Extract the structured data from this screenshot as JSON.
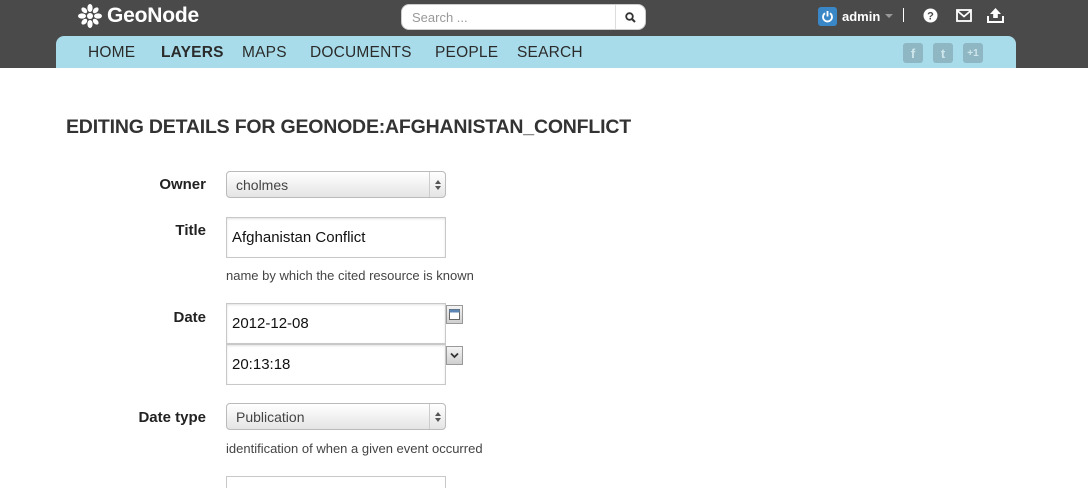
{
  "header": {
    "logo_text": "GeoNode",
    "search": {
      "placeholder": "Search ...",
      "value": ""
    },
    "user": {
      "name": "admin"
    },
    "icons": [
      "power-icon",
      "help-icon",
      "mail-icon",
      "upload-icon"
    ]
  },
  "nav": {
    "items": [
      {
        "label": "HOME",
        "active": false
      },
      {
        "label": "LAYERS",
        "active": true
      },
      {
        "label": "MAPS",
        "active": false
      },
      {
        "label": "DOCUMENTS",
        "active": false
      },
      {
        "label": "PEOPLE",
        "active": false
      },
      {
        "label": "SEARCH",
        "active": false
      }
    ],
    "social": [
      {
        "name": "facebook-icon",
        "glyph": "f"
      },
      {
        "name": "twitter-icon",
        "glyph": "t"
      },
      {
        "name": "google-plus-icon",
        "glyph": "+1"
      }
    ]
  },
  "page": {
    "title": "EDITING DETAILS FOR GEONODE:AFGHANISTAN_CONFLICT"
  },
  "form": {
    "owner": {
      "label": "Owner",
      "value": "cholmes"
    },
    "title": {
      "label": "Title",
      "value": "Afghanistan Conflict",
      "help": "name by which the cited resource is known"
    },
    "date": {
      "label": "Date",
      "date_value": "2012-12-08",
      "time_value": "20:13:18"
    },
    "date_type": {
      "label": "Date type",
      "value": "Publication",
      "help": "identification of when a given event occurred"
    }
  },
  "colors": {
    "topbar": "#4a4a4a",
    "navbar": "#a8dcea",
    "accent": "#3a87c8"
  }
}
